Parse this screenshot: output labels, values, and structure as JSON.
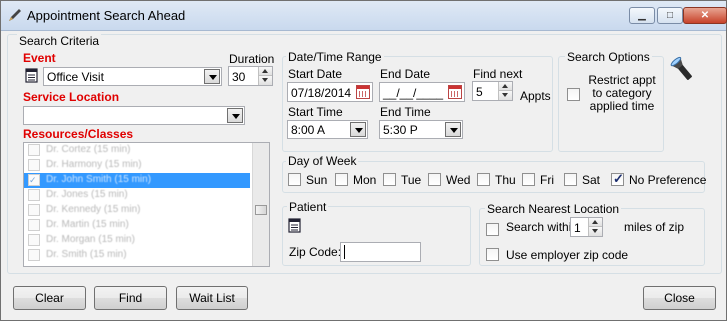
{
  "window": {
    "title": "Appointment Search Ahead",
    "minimize": "▁",
    "maximize": "□",
    "close": "✕"
  },
  "criteria": {
    "legend": "Search Criteria",
    "event_label": "Event",
    "event_value": "Office Visit",
    "duration_label": "Duration",
    "duration_value": "30",
    "service_location_label": "Service Location",
    "service_location_value": "",
    "resources_label": "Resources/Classes",
    "resources": [
      {
        "label": "Dr. Cortez (15 min)",
        "checked": false,
        "selected": false
      },
      {
        "label": "Dr. Harmony (15 min)",
        "checked": false,
        "selected": false
      },
      {
        "label": "Dr. John Smith (15 min)",
        "checked": true,
        "selected": true
      },
      {
        "label": "Dr. Jones (15 min)",
        "checked": false,
        "selected": false
      },
      {
        "label": "Dr. Kennedy (15 min)",
        "checked": false,
        "selected": false
      },
      {
        "label": "Dr. Martin (15 min)",
        "checked": false,
        "selected": false
      },
      {
        "label": "Dr. Morgan (15 min)",
        "checked": false,
        "selected": false
      },
      {
        "label": "Dr. Smith (15 min)",
        "checked": false,
        "selected": false
      }
    ]
  },
  "datetime": {
    "legend": "Date/Time Range",
    "start_date_label": "Start Date",
    "start_date_value": "07/18/2014",
    "end_date_label": "End Date",
    "end_date_value": "__/__/____",
    "find_next_label": "Find next",
    "find_next_value": "5",
    "appts_label": "Appts",
    "start_time_label": "Start Time",
    "start_time_value": "8:00 A",
    "end_time_label": "End Time",
    "end_time_value": "5:30 P"
  },
  "options": {
    "legend": "Search Options",
    "restrict_label": "Restrict appt to category applied time",
    "restrict_checked": false
  },
  "days": {
    "legend": "Day of Week",
    "items": [
      {
        "label": "Sun",
        "checked": false
      },
      {
        "label": "Mon",
        "checked": false
      },
      {
        "label": "Tue",
        "checked": false
      },
      {
        "label": "Wed",
        "checked": false
      },
      {
        "label": "Thu",
        "checked": false
      },
      {
        "label": "Fri",
        "checked": false
      },
      {
        "label": "Sat",
        "checked": false
      },
      {
        "label": "No Preference",
        "checked": true
      }
    ]
  },
  "patient": {
    "legend": "Patient",
    "zip_label": "Zip Code:",
    "zip_value": ""
  },
  "nearest": {
    "legend": "Search Nearest Location",
    "within_label": "Search within",
    "within_value": "1",
    "miles_label": "miles of zip",
    "employer_label": "Use employer zip code"
  },
  "buttons": {
    "clear": "Clear",
    "find": "Find",
    "wait_list": "Wait List",
    "close": "Close"
  },
  "colors": {
    "required_label": "#e00000",
    "selection": "#3399ff"
  }
}
